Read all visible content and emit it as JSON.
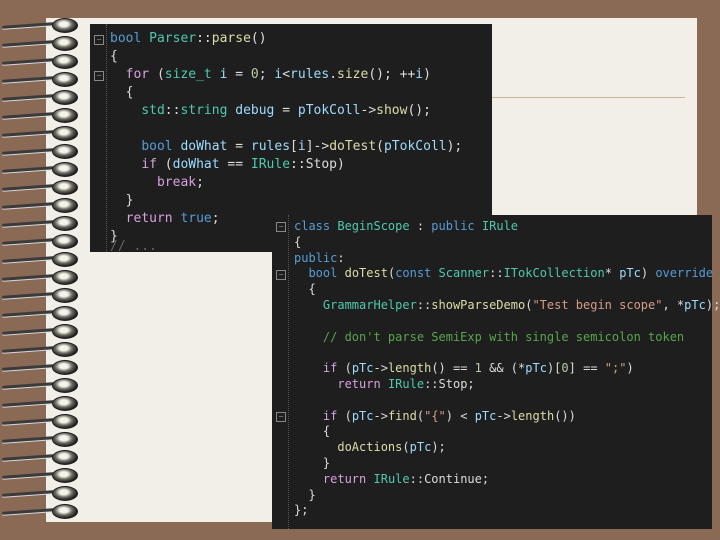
{
  "colors": {
    "background": "#8a6a55",
    "page": "#f2efe8",
    "editor": "#1e1e1e",
    "keyword": "#569cd6",
    "type": "#4ec9b0",
    "function": "#dcdcaa",
    "string": "#d69d85",
    "comment": "#57a64a"
  },
  "decor": {
    "spiral_binding_icon": "spiral-binding-icon"
  },
  "snippet1": {
    "lines": [
      "bool Parser::parse()",
      "{",
      "  for (size_t i = 0; i<rules.size(); ++i)",
      "  {",
      "    std::string debug = pTokColl->show();",
      "",
      "    bool doWhat = rules[i]->doTest(pTokColl);",
      "    if (doWhat == IRule::Stop)",
      "      break;",
      "  }",
      "  return true;",
      "}"
    ],
    "cutoff": "// ..."
  },
  "snippet2": {
    "lines": [
      "class BeginScope : public IRule",
      "{",
      "public:",
      "  bool doTest(const Scanner::ITokCollection* pTc) override",
      "  {",
      "    GrammarHelper::showParseDemo(\"Test begin scope\", *pTc);",
      "",
      "    // don't parse SemiExp with single semicolon token",
      "",
      "    if (pTc->length() == 1 && (*pTc)[0] == \";\")",
      "      return IRule::Stop;",
      "",
      "    if (pTc->find(\"{\") < pTc->length())",
      "    {",
      "      doActions(pTc);",
      "    }",
      "    return IRule::Continue;",
      "  }",
      "};"
    ]
  }
}
